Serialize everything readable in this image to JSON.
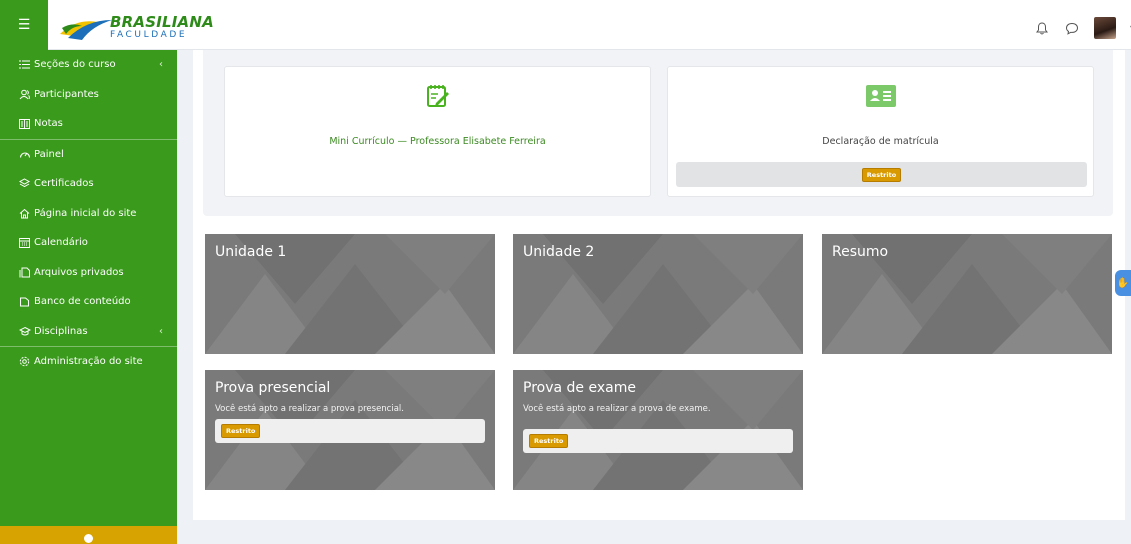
{
  "header": {
    "logo": {
      "word1": "BRASILIANA",
      "word2": "FACULDADE"
    },
    "icons": [
      "bell-icon",
      "chat-icon"
    ]
  },
  "sidebar": {
    "items": [
      {
        "label": "Seções do curso",
        "icon": "list-icon",
        "chevron": true
      },
      {
        "label": "Participantes",
        "icon": "users-icon"
      },
      {
        "label": "Notas",
        "icon": "grades-icon"
      },
      {
        "label": "Painel",
        "icon": "dashboard-icon"
      },
      {
        "label": "Certificados",
        "icon": "certificate-icon"
      },
      {
        "label": "Página inicial do site",
        "icon": "home-icon"
      },
      {
        "label": "Calendário",
        "icon": "calendar-icon"
      },
      {
        "label": "Arquivos privados",
        "icon": "files-icon"
      },
      {
        "label": "Banco de conteúdo",
        "icon": "bank-icon"
      },
      {
        "label": "Disciplinas",
        "icon": "graduation-icon",
        "chevron": true
      },
      {
        "label": "Administração do site",
        "icon": "settings-icon"
      }
    ]
  },
  "activities": [
    {
      "title": "Mini Currículo — Professora Elisabete Ferreira",
      "icon": "edit-note-icon"
    },
    {
      "title": "Declaração de matrícula",
      "icon": "id-card-icon",
      "restricted": "Restrito"
    }
  ],
  "tiles": [
    {
      "title": "Unidade 1"
    },
    {
      "title": "Unidade 2"
    },
    {
      "title": "Resumo"
    },
    {
      "title": "Prova presencial",
      "desc": "Você está apto a realizar a prova presencial.",
      "restricted": "Restrito"
    },
    {
      "title": "Prova de exame",
      "desc": "Você está apto a realizar a prova de exame.",
      "restricted": "Restrito"
    }
  ],
  "colors": {
    "brand_green": "#3a9a1c",
    "accent_yellow": "#d89a00",
    "tile_gray": "#7a7a7a"
  }
}
